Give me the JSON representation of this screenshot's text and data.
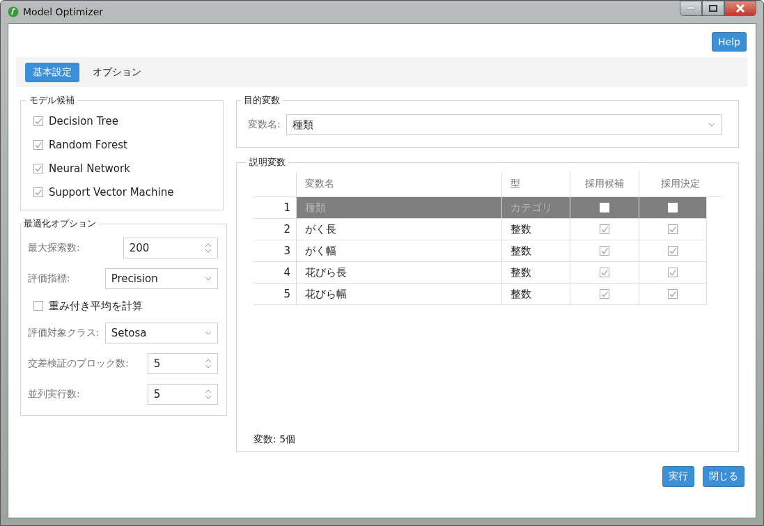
{
  "window": {
    "title": "Model Optimizer"
  },
  "help_button": "Help",
  "tabs": [
    {
      "label": "基本設定",
      "selected": true
    },
    {
      "label": "オプション",
      "selected": false
    }
  ],
  "model_candidates": {
    "title": "モデル候補",
    "items": [
      {
        "label": "Decision Tree",
        "checked": true
      },
      {
        "label": "Random Forest",
        "checked": true
      },
      {
        "label": "Neural Network",
        "checked": true
      },
      {
        "label": "Support Vector Machine",
        "checked": true
      }
    ]
  },
  "optimization_options": {
    "title": "最適化オプション",
    "fields": [
      {
        "kind": "spinner",
        "label": "最大探索数:",
        "value": "200"
      },
      {
        "kind": "dropdown",
        "label": "評価指標:",
        "value": "Precision"
      },
      {
        "kind": "checkbox",
        "label": "重み付き平均を計算",
        "checked": false
      },
      {
        "kind": "dropdown",
        "label": "評価対象クラス:",
        "value": "Setosa"
      },
      {
        "kind": "spinner",
        "label": "交差検証のブロック数:",
        "value": "5"
      },
      {
        "kind": "spinner",
        "label": "並列実行数:",
        "value": "5"
      }
    ]
  },
  "target_variable": {
    "title": "目的変数",
    "label": "変数名:",
    "value": "種類"
  },
  "explanatory_variables": {
    "title": "説明変数",
    "columns": [
      "変数名",
      "型",
      "採用候補",
      "採用決定"
    ],
    "rows": [
      {
        "index": "1",
        "name": "種類",
        "type": "カテゴリ",
        "candidate": false,
        "adopted": false,
        "selected": true
      },
      {
        "index": "2",
        "name": "がく長",
        "type": "整数",
        "candidate": true,
        "adopted": true,
        "selected": false
      },
      {
        "index": "3",
        "name": "がく幅",
        "type": "整数",
        "candidate": true,
        "adopted": true,
        "selected": false
      },
      {
        "index": "4",
        "name": "花びら長",
        "type": "整数",
        "candidate": true,
        "adopted": true,
        "selected": false
      },
      {
        "index": "5",
        "name": "花びら幅",
        "type": "整数",
        "candidate": true,
        "adopted": true,
        "selected": false
      }
    ],
    "count": "変数: 5個"
  },
  "buttons": [
    "実行",
    "閉じる"
  ]
}
